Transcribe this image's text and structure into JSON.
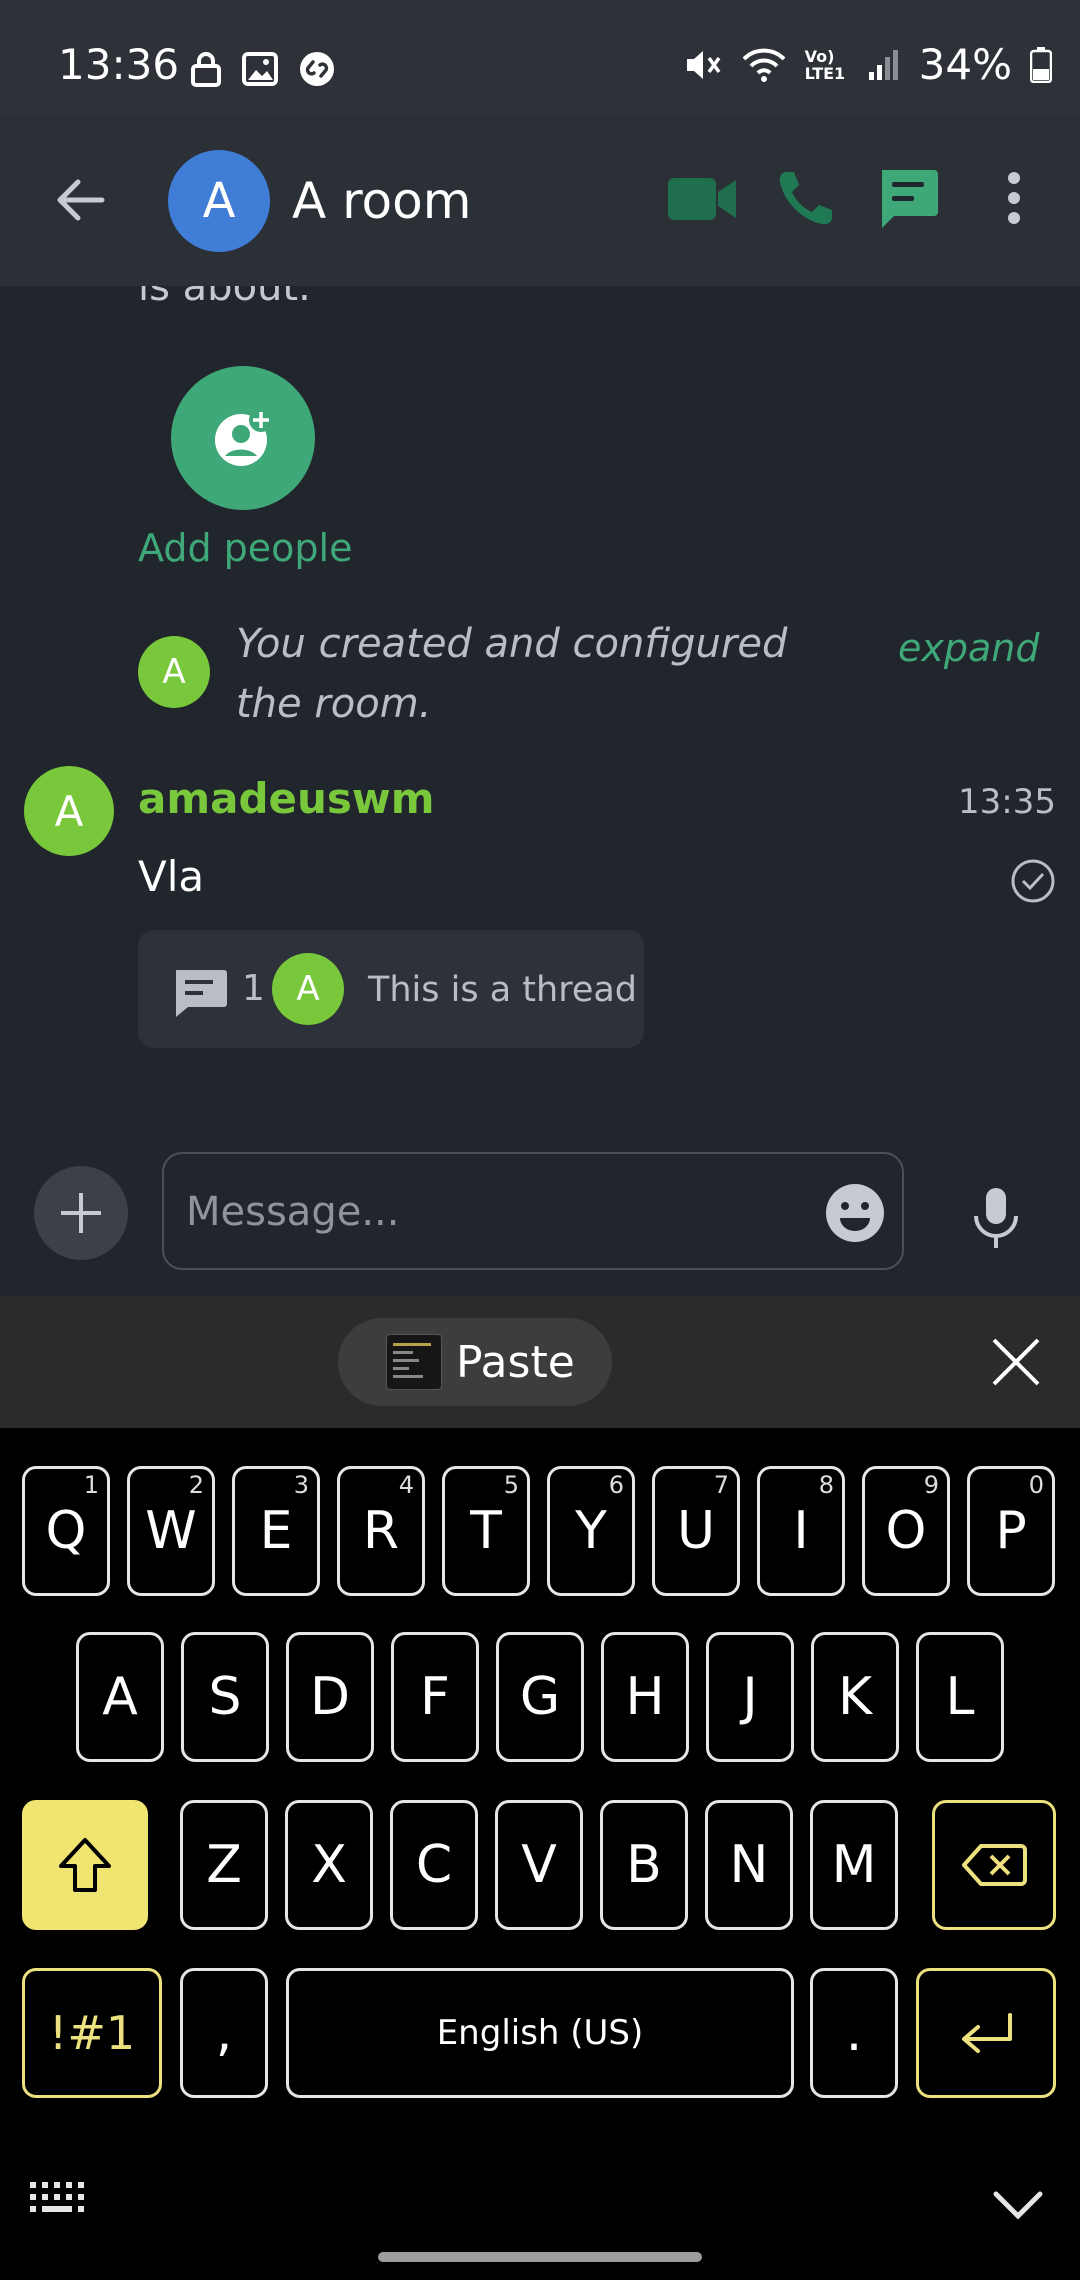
{
  "status_bar": {
    "time": "13:36",
    "battery": "34%",
    "network_label": "Vo) LTE1",
    "left_icons": [
      "lock-icon",
      "image-icon",
      "shazam-icon"
    ],
    "right_icons": [
      "mute-icon",
      "wifi-icon",
      "signal-icon",
      "battery-icon"
    ]
  },
  "header": {
    "room_initial": "A",
    "room_name": "A room",
    "icons": [
      "back-arrow-icon",
      "video-call-icon",
      "voice-call-icon",
      "threads-icon",
      "more-vert-icon"
    ]
  },
  "timeline": {
    "intro_text": "is about.",
    "add_people_label": "Add people",
    "created_event": {
      "avatar_initial": "A",
      "text": "You created and configured the room.",
      "expand_label": "expand"
    },
    "message": {
      "avatar_initial": "A",
      "sender": "amadeuswm",
      "time": "13:35",
      "body": "Vla"
    },
    "thread_summary": {
      "count": "1",
      "avatar_initial": "A",
      "latest": "This is a thread"
    }
  },
  "composer": {
    "placeholder": "Message..."
  },
  "clipboard": {
    "paste_label": "Paste"
  },
  "keyboard": {
    "row1": [
      {
        "k": "Q",
        "n": "1"
      },
      {
        "k": "W",
        "n": "2"
      },
      {
        "k": "E",
        "n": "3"
      },
      {
        "k": "R",
        "n": "4"
      },
      {
        "k": "T",
        "n": "5"
      },
      {
        "k": "Y",
        "n": "6"
      },
      {
        "k": "U",
        "n": "7"
      },
      {
        "k": "I",
        "n": "8"
      },
      {
        "k": "O",
        "n": "9"
      },
      {
        "k": "P",
        "n": "0"
      }
    ],
    "row2": [
      "A",
      "S",
      "D",
      "F",
      "G",
      "H",
      "J",
      "K",
      "L"
    ],
    "row3": [
      "Z",
      "X",
      "C",
      "V",
      "B",
      "N",
      "M"
    ],
    "symbols_label": "!#1",
    "comma": ",",
    "space_label": "English (US)",
    "period": ".",
    "accent_color": "#f0e571"
  },
  "colors": {
    "brand_green": "#3fa878",
    "user_green": "#79c83c",
    "room_avatar_blue": "#3f7dd6",
    "timeline_bg": "#21252c"
  }
}
